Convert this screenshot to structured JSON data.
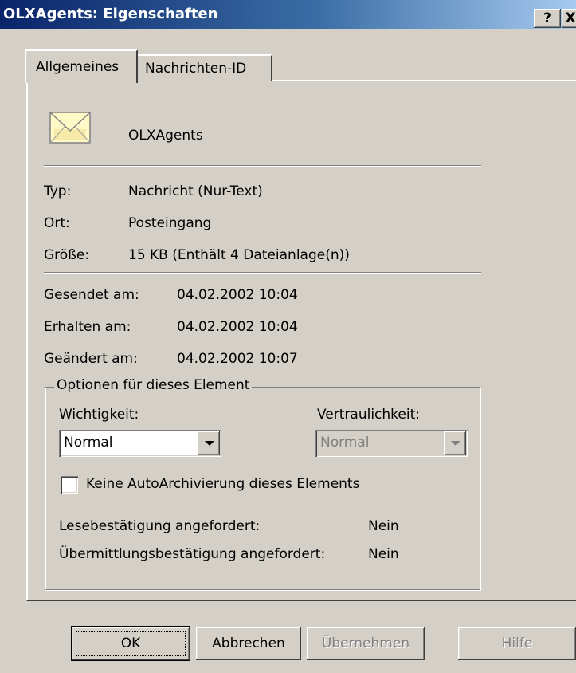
{
  "window": {
    "title": "OLXAgents: Eigenschaften",
    "help_button": "?",
    "close_button": "X"
  },
  "tabs": [
    {
      "label": "Allgemeines",
      "active": true
    },
    {
      "label": "Nachrichten-ID",
      "active": false
    }
  ],
  "general": {
    "item_name": "OLXAgents",
    "icon": "envelope-icon",
    "fields": [
      {
        "label": "Typ:",
        "value": "Nachricht  (Nur-Text)"
      },
      {
        "label": "Ort:",
        "value": "Posteingang"
      },
      {
        "label": "Größe:",
        "value": "15 KB (Enthält 4 Dateianlage(n))"
      }
    ],
    "dates": [
      {
        "label": "Gesendet am:",
        "value": "04.02.2002 10:04"
      },
      {
        "label": "Erhalten am:",
        "value": "04.02.2002 10:04"
      },
      {
        "label": "Geändert am:",
        "value": "04.02.2002 10:07"
      }
    ]
  },
  "options": {
    "group_label": "Optionen für dieses Element",
    "importance_label": "Wichtigkeit:",
    "importance_value": "Normal",
    "sensitivity_label": "Vertraulichkeit:",
    "sensitivity_value": "Normal",
    "no_autoarchive_label": "Keine AutoArchivierung dieses Elements",
    "read_receipt_label": "Lesebestätigung angefordert:",
    "read_receipt_value": "Nein",
    "delivery_receipt_label": "Übermittlungsbestätigung angefordert:",
    "delivery_receipt_value": "Nein"
  },
  "buttons": {
    "ok": "OK",
    "cancel": "Abbrechen",
    "apply": "Übernehmen",
    "help": "Hilfe"
  },
  "colors": {
    "title_gradient_start": "#0a246a",
    "title_gradient_end": "#a6caf0",
    "dialog_bg": "#d4d0c8"
  }
}
